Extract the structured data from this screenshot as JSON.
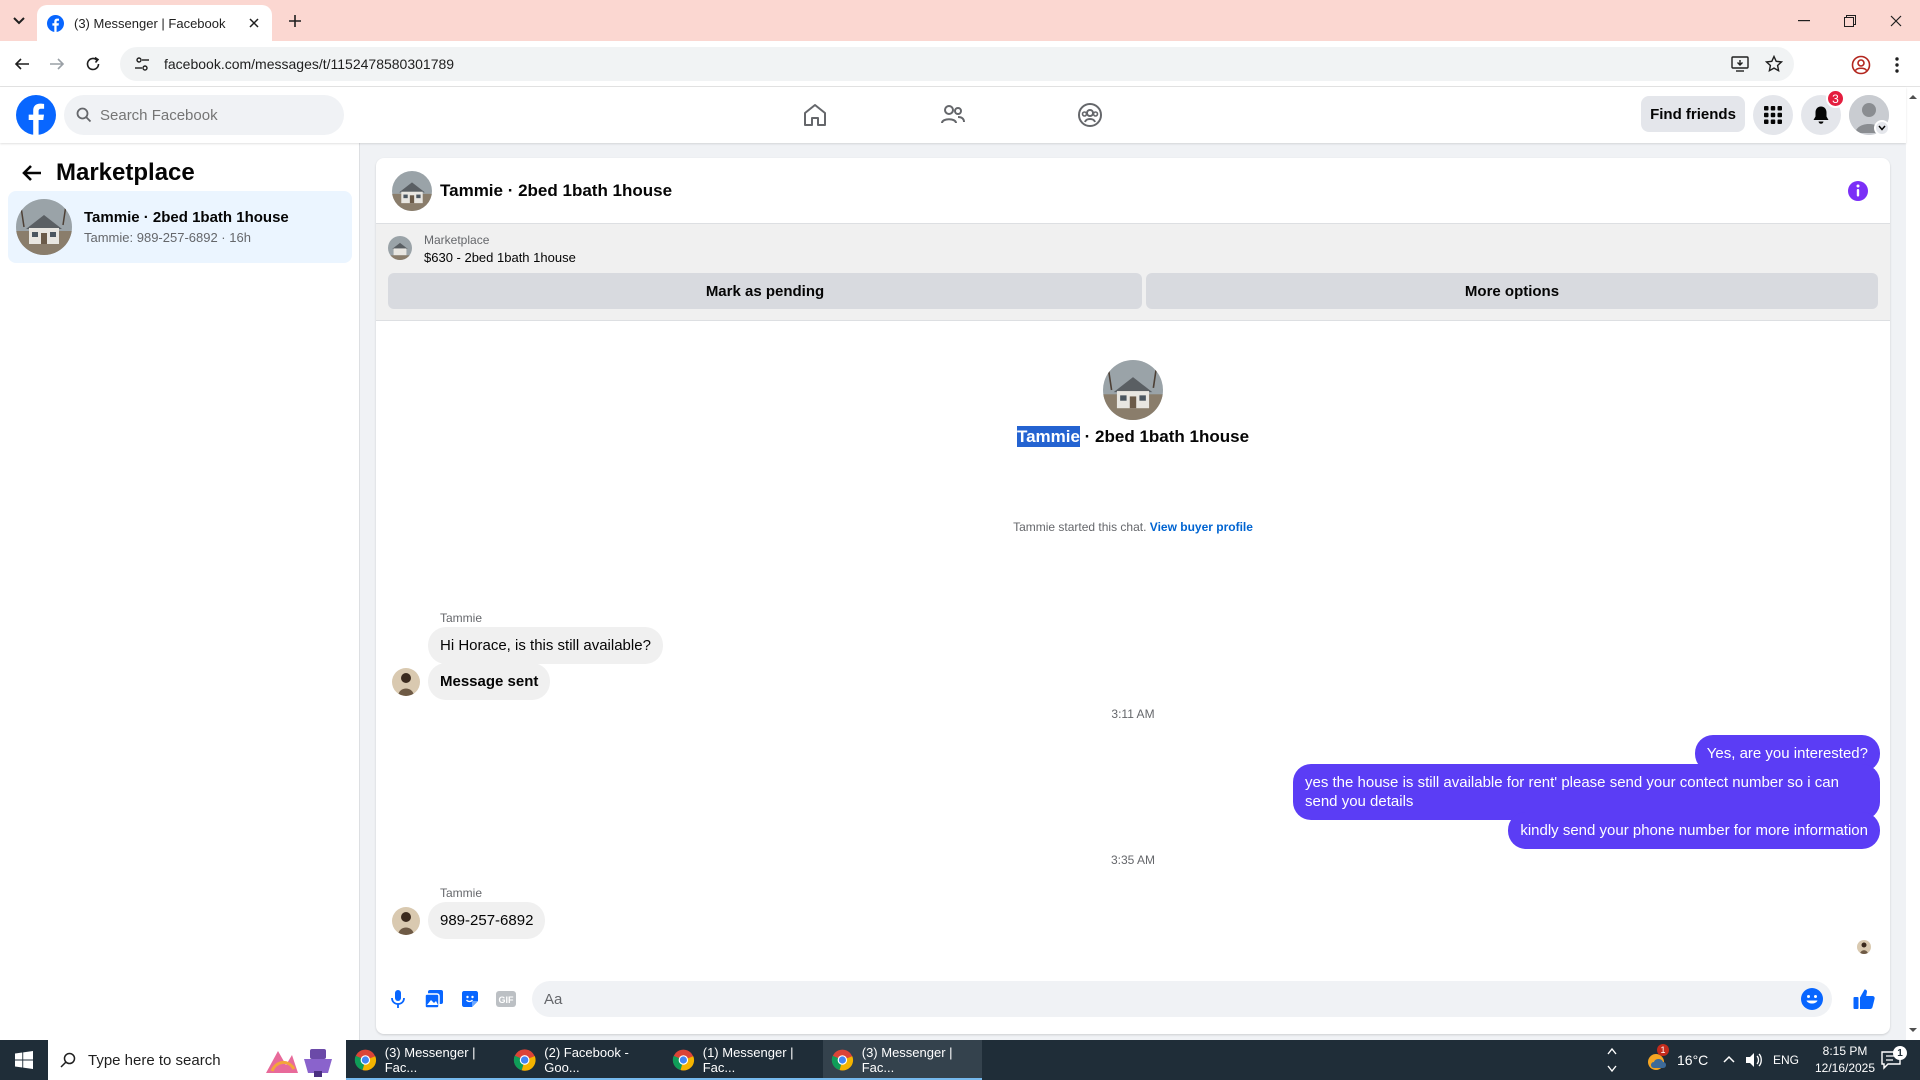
{
  "browser": {
    "tab_title": "(3) Messenger | Facebook",
    "url": "facebook.com/messages/t/1152478580301789"
  },
  "fb_header": {
    "search_placeholder": "Search Facebook",
    "find_friends": "Find friends",
    "notification_count": "3"
  },
  "sidebar": {
    "title": "Marketplace",
    "conversation": {
      "name": "Tammie · 2bed 1bath 1house",
      "preview": "Tammie: 989-257-6892 · 16h"
    }
  },
  "chat": {
    "header_title": "Tammie · 2bed 1bath 1house",
    "listing": {
      "label": "Marketplace",
      "price_title": "$630 - 2bed 1bath 1house",
      "mark_pending": "Mark as pending",
      "more_options": "More options"
    },
    "intro": {
      "name_selected": "Tammie",
      "title_rest": " · 2bed 1bath 1house",
      "started": "Tammie started this chat. ",
      "view_profile": "View buyer profile"
    },
    "messages": {
      "sender1": "Tammie",
      "in1": "Hi Horace, is this still available?",
      "in2": "Message sent",
      "time1": "3:11 AM",
      "out1": "Yes, are you interested?",
      "out2": "yes the house is still available for rent' please send your contect number so i can send you details",
      "out3": "kindly send your phone number for more information",
      "time2": "3:35 AM",
      "sender2": "Tammie",
      "in3": "989-257-6892"
    },
    "composer_placeholder": "Aa"
  },
  "taskbar": {
    "search_placeholder": "Type here to search",
    "apps": [
      "(3) Messenger | Fac...",
      "(2) Facebook - Goo...",
      "(1) Messenger | Fac...",
      "(3) Messenger | Fac..."
    ],
    "weather": "16°C",
    "lang": "ENG",
    "time": "8:15 PM",
    "date": "12/16/2025",
    "weather_badge": "1",
    "notif_count": "1"
  },
  "colors": {
    "fb_blue": "#0866ff",
    "messenger_purple": "#5b3df5",
    "tabbar": "#fbd7d1",
    "badge_red": "#e41e3f"
  }
}
